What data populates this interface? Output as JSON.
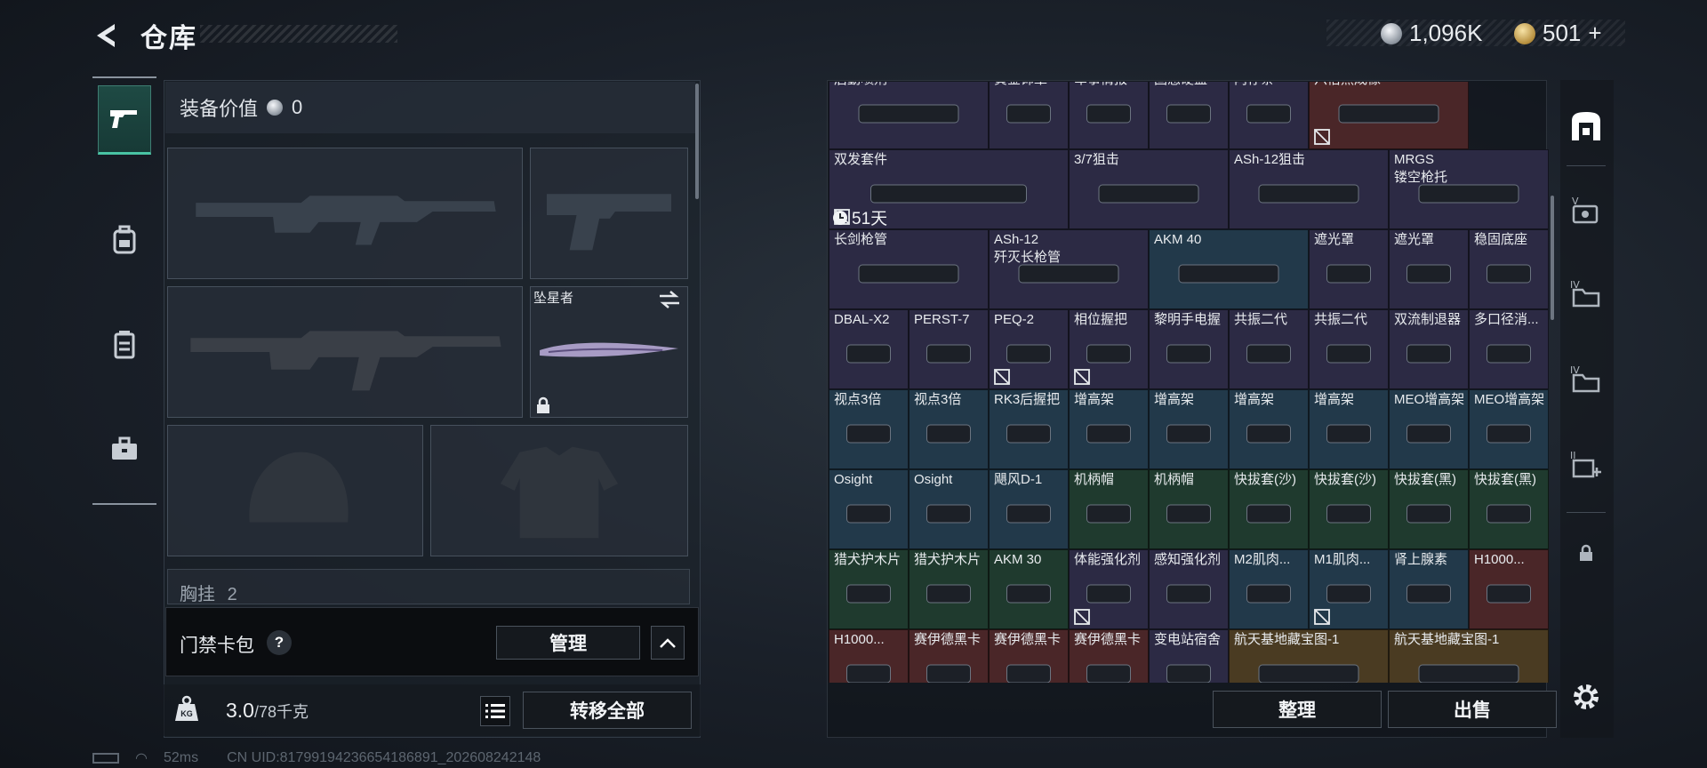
{
  "header": {
    "title": "仓库",
    "currency_silver": "1,096K",
    "currency_gold": "501",
    "currency_gold_plus": "+"
  },
  "loadout": {
    "equip_value_label": "装备价值",
    "equip_value": "0",
    "melee_name": "坠星者",
    "chest_label": "胸挂",
    "chest_count": "2"
  },
  "keycard": {
    "label": "门禁卡包",
    "help": "?",
    "manage": "管理"
  },
  "weight": {
    "current": "3.0",
    "max": "/78千克",
    "transfer_all": "转移全部",
    "kg_badge": "KG"
  },
  "status": {
    "ping": "52ms",
    "uid": "CN UID:81799194236654186891_202608242148"
  },
  "stash": {
    "timer": "51天",
    "sort": "整理",
    "sell": "出售",
    "items": [
      {
        "label": "后勤喷剂",
        "color": "c-purple"
      },
      {
        "label": "黄金饰章",
        "color": "c-purple"
      },
      {
        "label": "军事情报",
        "color": "c-purple"
      },
      {
        "label": "固态硬盘",
        "color": "c-purple"
      },
      {
        "label": "内存条",
        "color": "c-purple"
      },
      {
        "label": "六倍热成像",
        "color": "c-red"
      },
      {
        "label": "双发套件",
        "color": "c-purple"
      },
      {
        "label": "3/7狙击",
        "color": "c-purple"
      },
      {
        "label": "ASh-12狙击",
        "color": "c-purple"
      },
      {
        "label": "MRGS",
        "label2": "镂空枪托",
        "color": "c-purple"
      },
      {
        "label": "长剑枪管",
        "color": "c-purple"
      },
      {
        "label": "ASh-12",
        "label2": "歼灭长枪管",
        "color": "c-purple"
      },
      {
        "label": "AKM 40",
        "color": "c-blue"
      },
      {
        "label": "遮光罩",
        "color": "c-purple"
      },
      {
        "label": "遮光罩",
        "color": "c-purple"
      },
      {
        "label": "稳固底座",
        "color": "c-purple"
      },
      {
        "label": "DBAL-X2",
        "color": "c-purple"
      },
      {
        "label": "PERST-7",
        "color": "c-purple"
      },
      {
        "label": "PEQ-2",
        "color": "c-purple"
      },
      {
        "label": "相位握把",
        "color": "c-purple"
      },
      {
        "label": "黎明手电握",
        "color": "c-purple"
      },
      {
        "label": "共振二代",
        "color": "c-purple"
      },
      {
        "label": "共振二代",
        "color": "c-purple"
      },
      {
        "label": "双流制退器",
        "color": "c-purple"
      },
      {
        "label": "多口径消...",
        "color": "c-purple"
      },
      {
        "label": "视点3倍",
        "color": "c-blue"
      },
      {
        "label": "视点3倍",
        "color": "c-blue"
      },
      {
        "label": "RK3后握把",
        "color": "c-blue"
      },
      {
        "label": "增高架",
        "color": "c-blue"
      },
      {
        "label": "增高架",
        "color": "c-blue"
      },
      {
        "label": "增高架",
        "color": "c-blue"
      },
      {
        "label": "增高架",
        "color": "c-blue"
      },
      {
        "label": "MEO增高架",
        "color": "c-blue"
      },
      {
        "label": "MEO增高架",
        "color": "c-blue"
      },
      {
        "label": "Osight",
        "color": "c-blue"
      },
      {
        "label": "Osight",
        "color": "c-blue"
      },
      {
        "label": "飓风D-1",
        "color": "c-blue"
      },
      {
        "label": "机柄帽",
        "color": "c-green"
      },
      {
        "label": "机柄帽",
        "color": "c-green"
      },
      {
        "label": "快拔套(沙)",
        "color": "c-green"
      },
      {
        "label": "快拔套(沙)",
        "color": "c-green"
      },
      {
        "label": "快拔套(黑)",
        "color": "c-green"
      },
      {
        "label": "快拔套(黑)",
        "color": "c-green"
      },
      {
        "label": "猎犬护木片",
        "color": "c-green"
      },
      {
        "label": "猎犬护木片",
        "color": "c-green"
      },
      {
        "label": "AKM 30",
        "color": "c-green"
      },
      {
        "label": "体能强化剂",
        "color": "c-purple"
      },
      {
        "label": "感知强化剂",
        "color": "c-purple"
      },
      {
        "label": "M2肌肉...",
        "color": "c-blue"
      },
      {
        "label": "M1肌肉...",
        "color": "c-blue"
      },
      {
        "label": "肾上腺素",
        "color": "c-blue"
      },
      {
        "label": "H1000...",
        "color": "c-red"
      },
      {
        "label": "H1000...",
        "color": "c-red"
      },
      {
        "label": "赛伊德黑卡",
        "color": "c-red"
      },
      {
        "label": "赛伊德黑卡",
        "color": "c-red"
      },
      {
        "label": "赛伊德黑卡",
        "color": "c-red"
      },
      {
        "label": "变电站宿舍",
        "color": "c-purple"
      },
      {
        "label": "航天基地藏宝图-1",
        "color": "c-gold"
      },
      {
        "label": "航天基地藏宝图-1",
        "color": "c-gold"
      }
    ]
  },
  "colors": {
    "accent_teal": "#49c4a4",
    "purple_rarity": "#2c2a44",
    "red_rarity": "#4a2628",
    "blue_rarity": "#22394a",
    "green_rarity": "#1f3a2e",
    "gold_rarity": "#4a3b22"
  },
  "icons": [
    "back-arrow-icon",
    "pistol-icon",
    "backpack-icon",
    "vest-icon",
    "briefcase-icon",
    "safe-icon",
    "keycard-icon",
    "lock-icon",
    "gear-icon",
    "weight-icon",
    "list-icon",
    "chevron-up-icon",
    "clock-icon",
    "no-trade-icon"
  ]
}
